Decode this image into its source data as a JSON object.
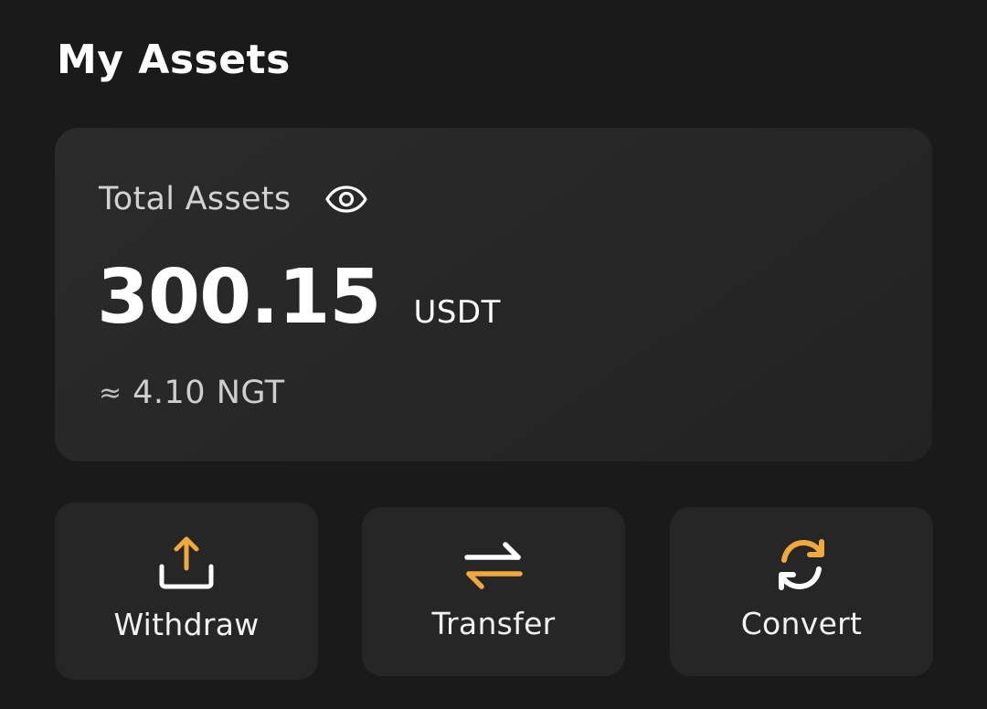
{
  "page": {
    "title": "My Assets"
  },
  "assets_card": {
    "label": "Total Assets",
    "visibility_icon": "eye-icon",
    "amount": "300.15",
    "currency": "USDT",
    "approx_symbol": "≈",
    "approx_value": "4.10 NGT"
  },
  "actions": [
    {
      "label": "Withdraw",
      "icon": "upload-icon"
    },
    {
      "label": "Transfer",
      "icon": "swap-arrows-icon"
    },
    {
      "label": "Convert",
      "icon": "refresh-icon"
    }
  ],
  "colors": {
    "background": "#1a1a1a",
    "card": "#262626",
    "accent": "#f0a93b",
    "text": "#ffffff"
  }
}
